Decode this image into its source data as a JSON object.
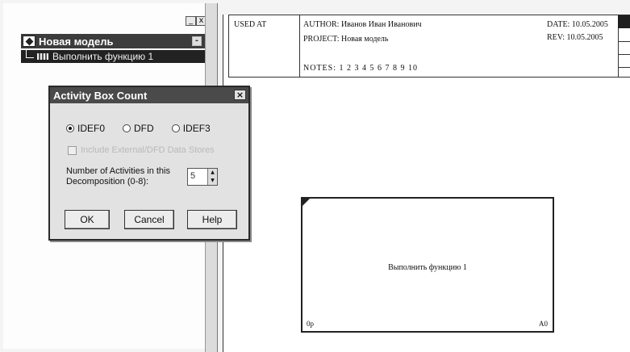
{
  "tree": {
    "panel_controls": [
      "_",
      "x"
    ],
    "root_label": "Новая модель",
    "root_collapse": "-",
    "child_label": "Выполнить функцию 1"
  },
  "dialog": {
    "title": "Activity Box Count",
    "close": "×",
    "radios": [
      {
        "label": "IDEF0",
        "checked": true
      },
      {
        "label": "DFD",
        "checked": false
      },
      {
        "label": "IDEF3",
        "checked": false
      }
    ],
    "include_label": "Include External/DFD Data Stores",
    "include_checked": false,
    "num_label_line1": "Number of Activities in this",
    "num_label_line2": "Decomposition (0-8):",
    "num_value": "5",
    "buttons": {
      "ok": "OK",
      "cancel": "Cancel",
      "help": "Help"
    }
  },
  "diagram": {
    "used_at": "USED AT",
    "author": "AUTHOR:  Иванов Иван Иванович",
    "project": "PROJECT:  Новая модель",
    "notes": "NOTES:  1  2  3  4  5  6  7  8  9  10",
    "date": "DATE:  10.05.2005",
    "rev": "REV:    10.05.2005",
    "activity": {
      "name": "Выполнить функцию 1",
      "cost": "0р",
      "number": "A0"
    }
  }
}
